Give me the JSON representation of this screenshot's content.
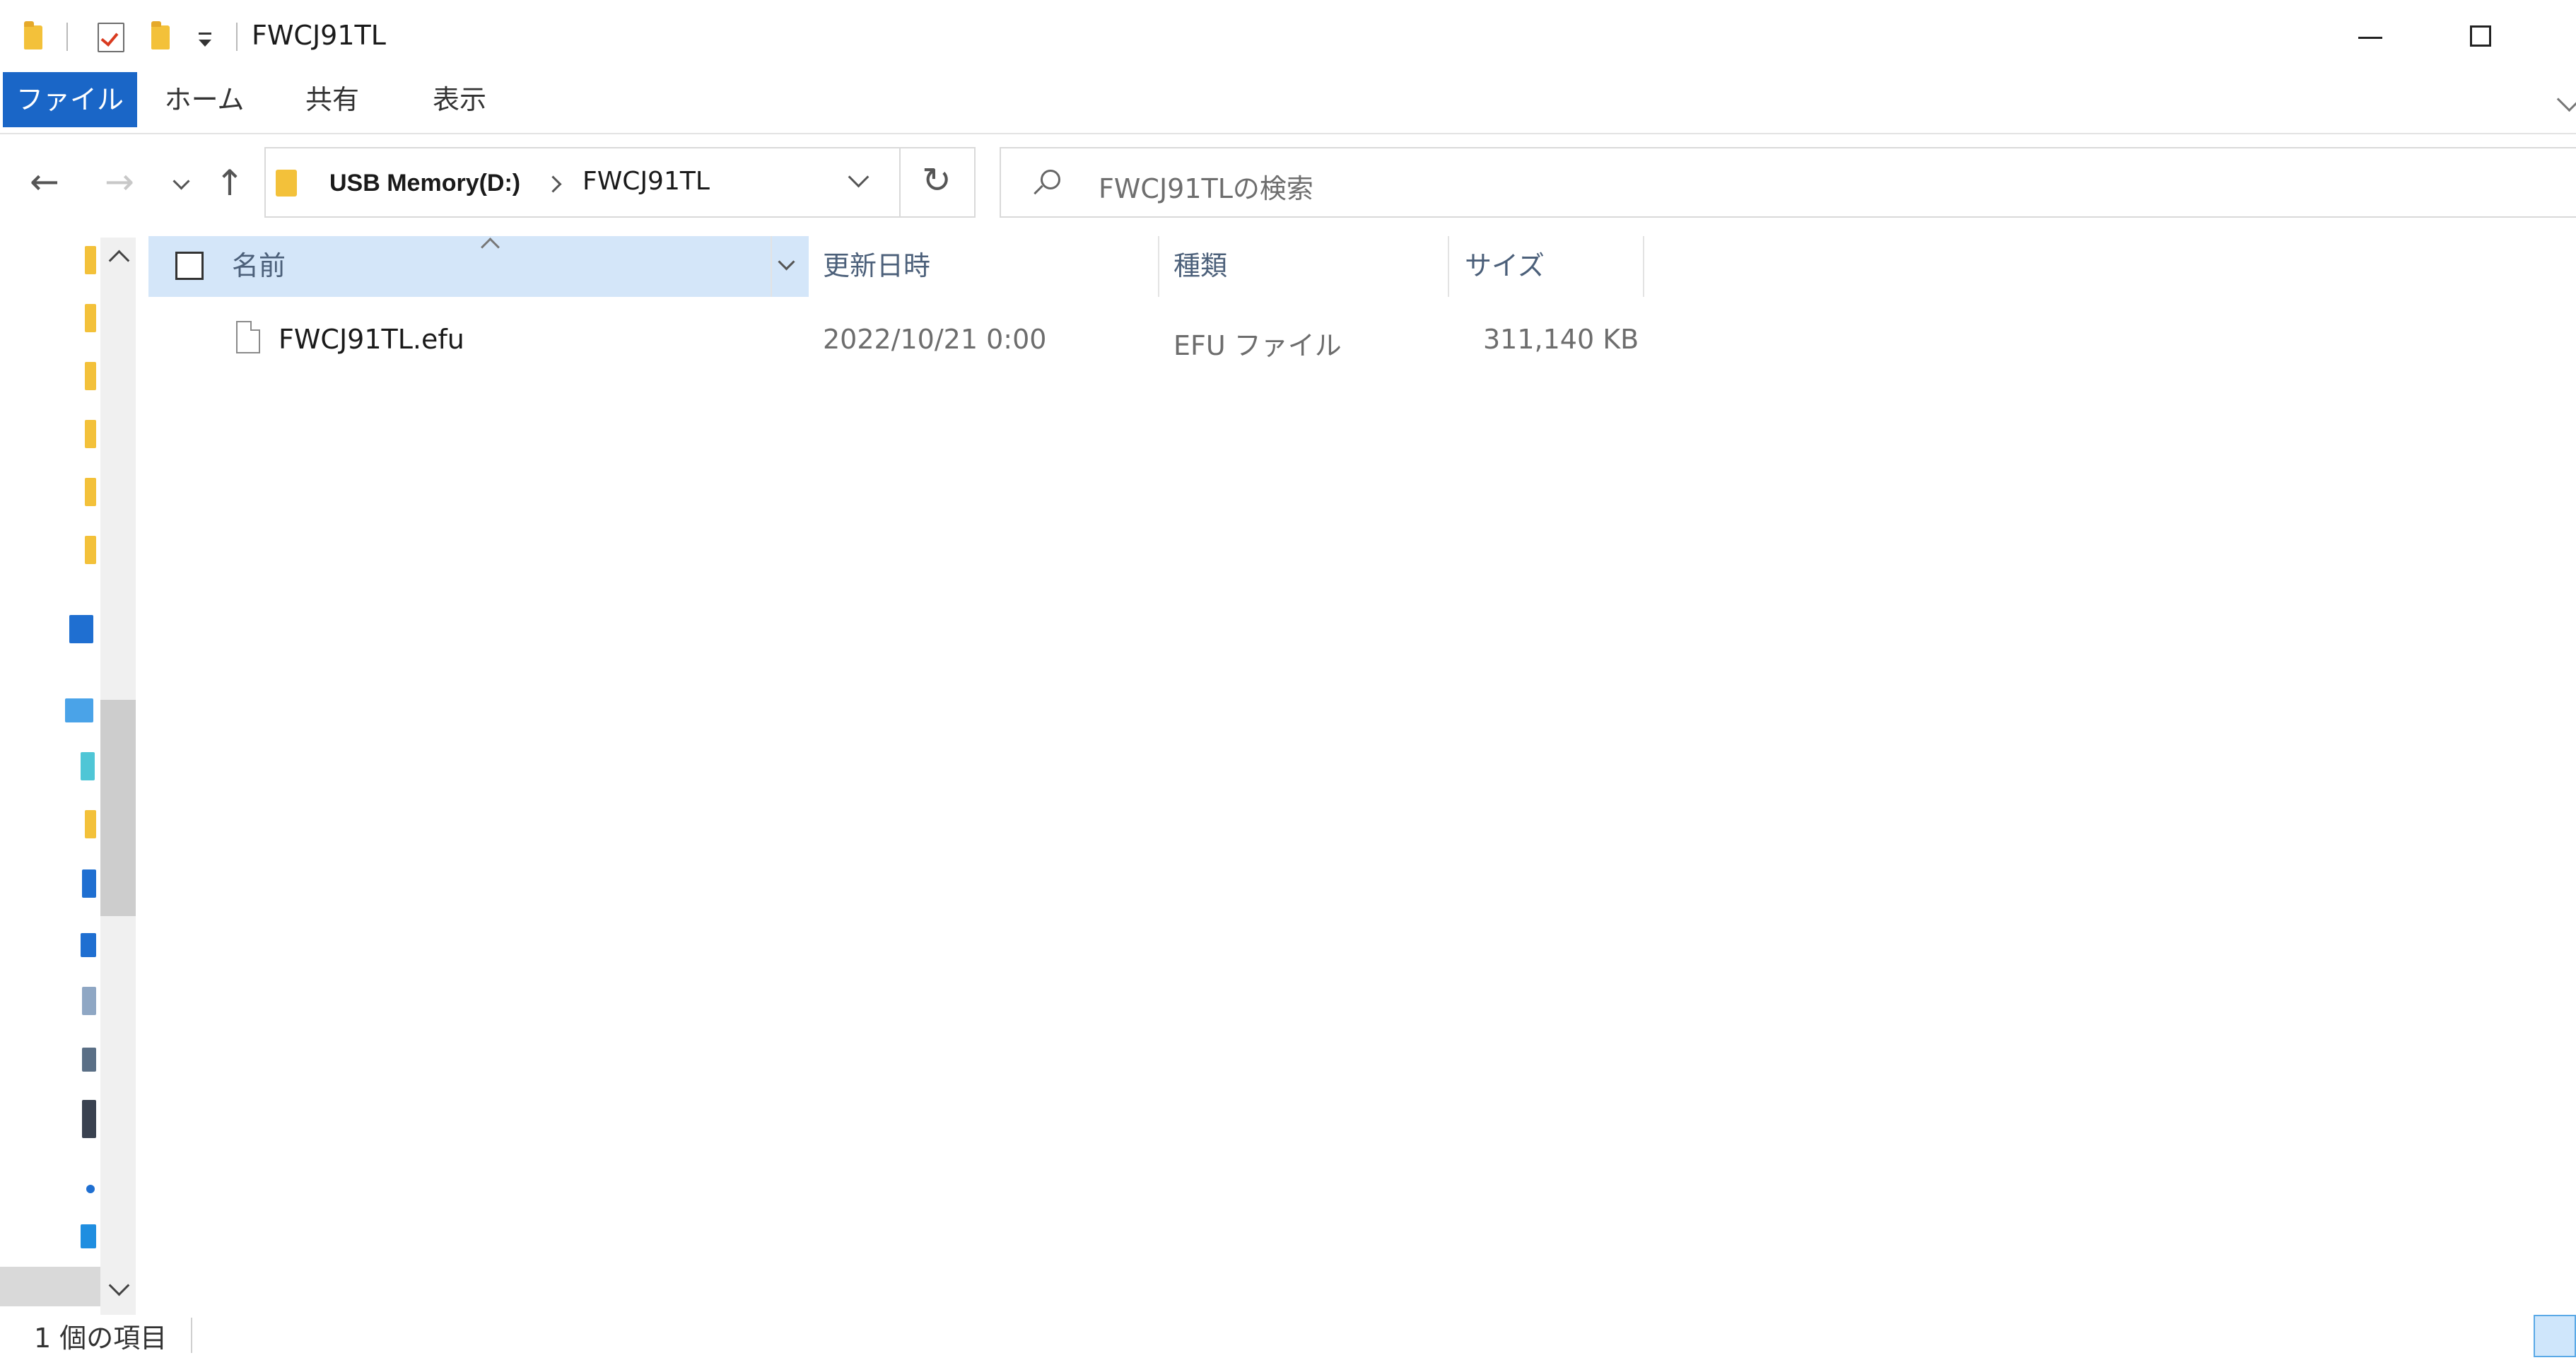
{
  "window": {
    "title": "FWCJ91TL"
  },
  "ribbon": {
    "tabs": [
      "ファイル",
      "ホーム",
      "共有",
      "表示"
    ]
  },
  "address": {
    "crumbs": [
      "USB Memory(D:)",
      "FWCJ91TL"
    ]
  },
  "search": {
    "placeholder": "FWCJ91TLの検索"
  },
  "columns": {
    "name": "名前",
    "modified": "更新日時",
    "type": "種類",
    "size": "サイズ"
  },
  "files": [
    {
      "name": "FWCJ91TL.efu",
      "modified": "2022/10/21 0:00",
      "type": "EFU ファイル",
      "size": "311,140 KB"
    }
  ],
  "status": {
    "item_count": "1 個の項目"
  },
  "colors": {
    "file_tab": "#1a66c7",
    "selected_header": "#d4e6f9",
    "folder_yellow": "#f3c13a"
  }
}
